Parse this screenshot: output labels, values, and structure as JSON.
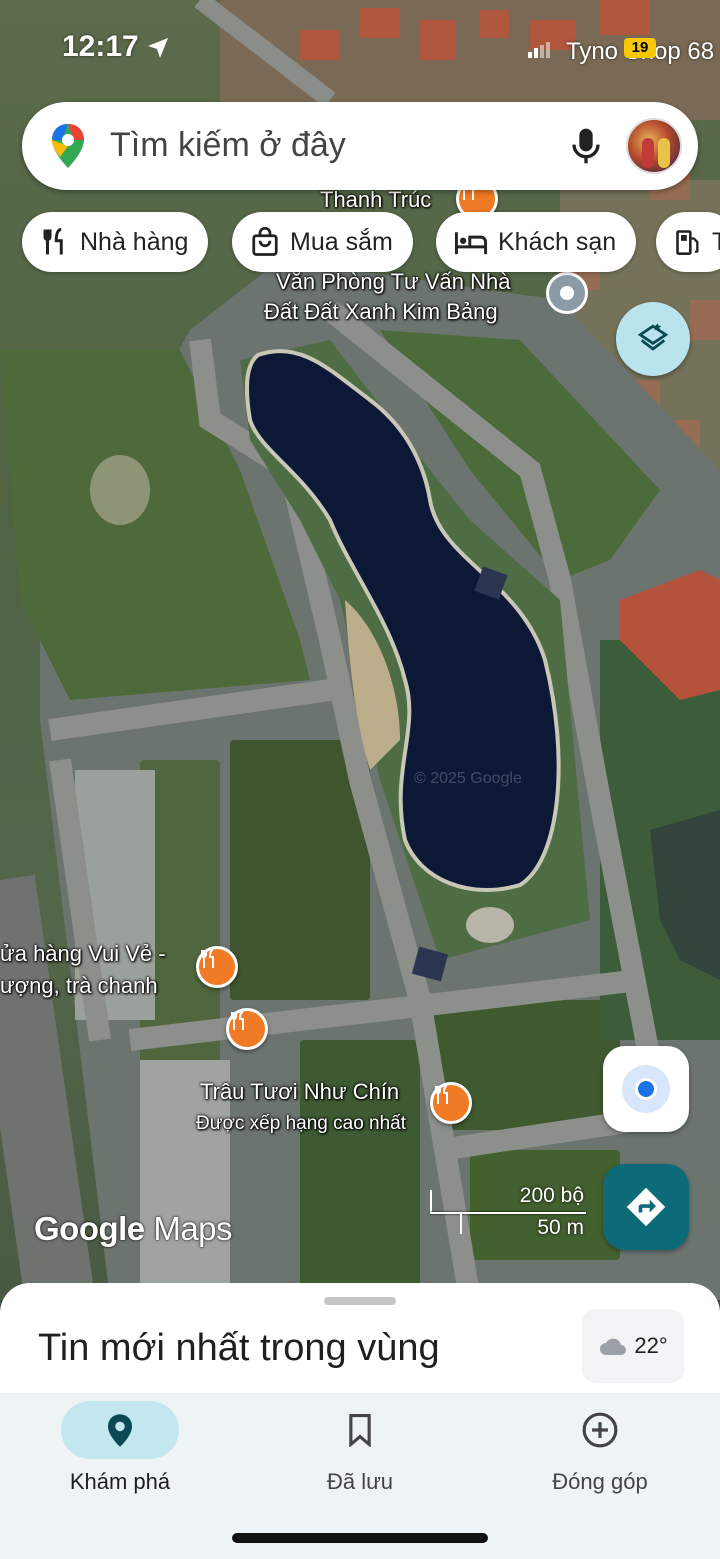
{
  "status_bar": {
    "time": "12:17",
    "carrier": "Tyno Shop 68",
    "battery": "19"
  },
  "search": {
    "placeholder": "Tìm kiếm ở đây"
  },
  "chips": [
    {
      "label": "Nhà hàng",
      "icon": "restaurant-icon"
    },
    {
      "label": "Mua sắm",
      "icon": "shopping-bag-icon"
    },
    {
      "label": "Khách sạn",
      "icon": "hotel-bed-icon"
    },
    {
      "label": "T",
      "icon": "gas-station-icon"
    }
  ],
  "map_labels": {
    "thanh_truc": "Thanh Trúc",
    "office_line1": "Văn Phòng Tư Vấn Nhà",
    "office_line2": "Đất Đất Xanh Kim Bảng",
    "store_line1": "ửa hàng Vui Vẻ -",
    "store_line2": "ượng, trà chanh",
    "trau_name": "Trâu Tươi Như Chín",
    "trau_sub": "Được xếp hạng cao nhất",
    "watermark": "© 2025 Google"
  },
  "scale": {
    "imperial": "200 bộ",
    "metric": "50 m"
  },
  "logo": {
    "google": "Google",
    "maps": "Maps"
  },
  "sheet": {
    "title": "Tin mới nhất trong vùng",
    "temperature": "22°"
  },
  "nav": [
    {
      "label": "Khám phá",
      "icon": "explore-pin-icon",
      "active": true
    },
    {
      "label": "Đã lưu",
      "icon": "bookmark-icon",
      "active": false
    },
    {
      "label": "Đóng góp",
      "icon": "add-circle-icon",
      "active": false
    }
  ],
  "colors": {
    "accent": "#0d6b79",
    "food_pin": "#f07a25",
    "active_nav": "#c2e7ee",
    "location_blue": "#1a73e8"
  }
}
